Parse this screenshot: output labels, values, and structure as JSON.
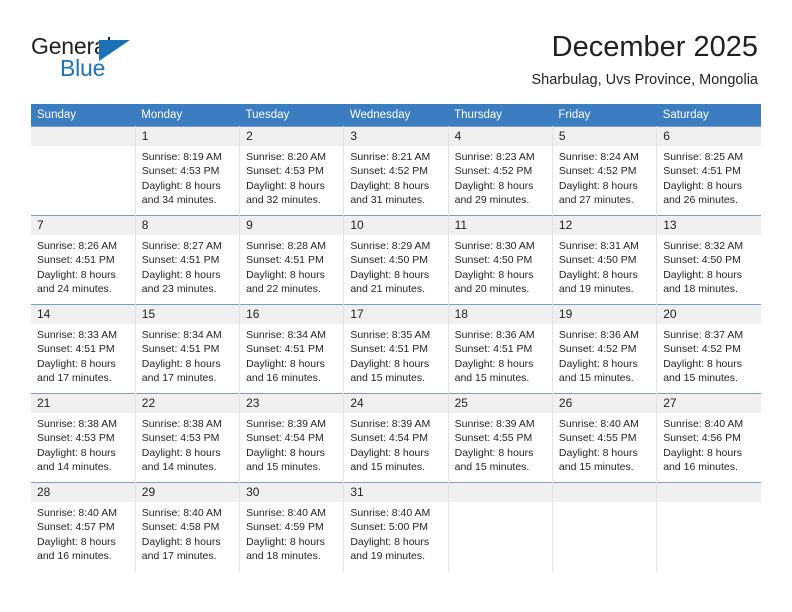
{
  "brand": {
    "name_part1": "General",
    "name_part2": "Blue",
    "triangle_icon": "triangle-logo-icon",
    "accent_color": "#1b72b8"
  },
  "header": {
    "title": "December 2025",
    "subtitle": "Sharbulag, Uvs Province, Mongolia"
  },
  "calendar": {
    "header_bg": "#3b7dc0",
    "daynum_bg": "#f0f0f0",
    "weekdays": [
      "Sunday",
      "Monday",
      "Tuesday",
      "Wednesday",
      "Thursday",
      "Friday",
      "Saturday"
    ],
    "weeks": [
      [
        {
          "day": "",
          "sunrise": "",
          "sunset": "",
          "daylight1": "",
          "daylight2": ""
        },
        {
          "day": "1",
          "sunrise": "Sunrise: 8:19 AM",
          "sunset": "Sunset: 4:53 PM",
          "daylight1": "Daylight: 8 hours",
          "daylight2": "and 34 minutes."
        },
        {
          "day": "2",
          "sunrise": "Sunrise: 8:20 AM",
          "sunset": "Sunset: 4:53 PM",
          "daylight1": "Daylight: 8 hours",
          "daylight2": "and 32 minutes."
        },
        {
          "day": "3",
          "sunrise": "Sunrise: 8:21 AM",
          "sunset": "Sunset: 4:52 PM",
          "daylight1": "Daylight: 8 hours",
          "daylight2": "and 31 minutes."
        },
        {
          "day": "4",
          "sunrise": "Sunrise: 8:23 AM",
          "sunset": "Sunset: 4:52 PM",
          "daylight1": "Daylight: 8 hours",
          "daylight2": "and 29 minutes."
        },
        {
          "day": "5",
          "sunrise": "Sunrise: 8:24 AM",
          "sunset": "Sunset: 4:52 PM",
          "daylight1": "Daylight: 8 hours",
          "daylight2": "and 27 minutes."
        },
        {
          "day": "6",
          "sunrise": "Sunrise: 8:25 AM",
          "sunset": "Sunset: 4:51 PM",
          "daylight1": "Daylight: 8 hours",
          "daylight2": "and 26 minutes."
        }
      ],
      [
        {
          "day": "7",
          "sunrise": "Sunrise: 8:26 AM",
          "sunset": "Sunset: 4:51 PM",
          "daylight1": "Daylight: 8 hours",
          "daylight2": "and 24 minutes."
        },
        {
          "day": "8",
          "sunrise": "Sunrise: 8:27 AM",
          "sunset": "Sunset: 4:51 PM",
          "daylight1": "Daylight: 8 hours",
          "daylight2": "and 23 minutes."
        },
        {
          "day": "9",
          "sunrise": "Sunrise: 8:28 AM",
          "sunset": "Sunset: 4:51 PM",
          "daylight1": "Daylight: 8 hours",
          "daylight2": "and 22 minutes."
        },
        {
          "day": "10",
          "sunrise": "Sunrise: 8:29 AM",
          "sunset": "Sunset: 4:50 PM",
          "daylight1": "Daylight: 8 hours",
          "daylight2": "and 21 minutes."
        },
        {
          "day": "11",
          "sunrise": "Sunrise: 8:30 AM",
          "sunset": "Sunset: 4:50 PM",
          "daylight1": "Daylight: 8 hours",
          "daylight2": "and 20 minutes."
        },
        {
          "day": "12",
          "sunrise": "Sunrise: 8:31 AM",
          "sunset": "Sunset: 4:50 PM",
          "daylight1": "Daylight: 8 hours",
          "daylight2": "and 19 minutes."
        },
        {
          "day": "13",
          "sunrise": "Sunrise: 8:32 AM",
          "sunset": "Sunset: 4:50 PM",
          "daylight1": "Daylight: 8 hours",
          "daylight2": "and 18 minutes."
        }
      ],
      [
        {
          "day": "14",
          "sunrise": "Sunrise: 8:33 AM",
          "sunset": "Sunset: 4:51 PM",
          "daylight1": "Daylight: 8 hours",
          "daylight2": "and 17 minutes."
        },
        {
          "day": "15",
          "sunrise": "Sunrise: 8:34 AM",
          "sunset": "Sunset: 4:51 PM",
          "daylight1": "Daylight: 8 hours",
          "daylight2": "and 17 minutes."
        },
        {
          "day": "16",
          "sunrise": "Sunrise: 8:34 AM",
          "sunset": "Sunset: 4:51 PM",
          "daylight1": "Daylight: 8 hours",
          "daylight2": "and 16 minutes."
        },
        {
          "day": "17",
          "sunrise": "Sunrise: 8:35 AM",
          "sunset": "Sunset: 4:51 PM",
          "daylight1": "Daylight: 8 hours",
          "daylight2": "and 15 minutes."
        },
        {
          "day": "18",
          "sunrise": "Sunrise: 8:36 AM",
          "sunset": "Sunset: 4:51 PM",
          "daylight1": "Daylight: 8 hours",
          "daylight2": "and 15 minutes."
        },
        {
          "day": "19",
          "sunrise": "Sunrise: 8:36 AM",
          "sunset": "Sunset: 4:52 PM",
          "daylight1": "Daylight: 8 hours",
          "daylight2": "and 15 minutes."
        },
        {
          "day": "20",
          "sunrise": "Sunrise: 8:37 AM",
          "sunset": "Sunset: 4:52 PM",
          "daylight1": "Daylight: 8 hours",
          "daylight2": "and 15 minutes."
        }
      ],
      [
        {
          "day": "21",
          "sunrise": "Sunrise: 8:38 AM",
          "sunset": "Sunset: 4:53 PM",
          "daylight1": "Daylight: 8 hours",
          "daylight2": "and 14 minutes."
        },
        {
          "day": "22",
          "sunrise": "Sunrise: 8:38 AM",
          "sunset": "Sunset: 4:53 PM",
          "daylight1": "Daylight: 8 hours",
          "daylight2": "and 14 minutes."
        },
        {
          "day": "23",
          "sunrise": "Sunrise: 8:39 AM",
          "sunset": "Sunset: 4:54 PM",
          "daylight1": "Daylight: 8 hours",
          "daylight2": "and 15 minutes."
        },
        {
          "day": "24",
          "sunrise": "Sunrise: 8:39 AM",
          "sunset": "Sunset: 4:54 PM",
          "daylight1": "Daylight: 8 hours",
          "daylight2": "and 15 minutes."
        },
        {
          "day": "25",
          "sunrise": "Sunrise: 8:39 AM",
          "sunset": "Sunset: 4:55 PM",
          "daylight1": "Daylight: 8 hours",
          "daylight2": "and 15 minutes."
        },
        {
          "day": "26",
          "sunrise": "Sunrise: 8:40 AM",
          "sunset": "Sunset: 4:55 PM",
          "daylight1": "Daylight: 8 hours",
          "daylight2": "and 15 minutes."
        },
        {
          "day": "27",
          "sunrise": "Sunrise: 8:40 AM",
          "sunset": "Sunset: 4:56 PM",
          "daylight1": "Daylight: 8 hours",
          "daylight2": "and 16 minutes."
        }
      ],
      [
        {
          "day": "28",
          "sunrise": "Sunrise: 8:40 AM",
          "sunset": "Sunset: 4:57 PM",
          "daylight1": "Daylight: 8 hours",
          "daylight2": "and 16 minutes."
        },
        {
          "day": "29",
          "sunrise": "Sunrise: 8:40 AM",
          "sunset": "Sunset: 4:58 PM",
          "daylight1": "Daylight: 8 hours",
          "daylight2": "and 17 minutes."
        },
        {
          "day": "30",
          "sunrise": "Sunrise: 8:40 AM",
          "sunset": "Sunset: 4:59 PM",
          "daylight1": "Daylight: 8 hours",
          "daylight2": "and 18 minutes."
        },
        {
          "day": "31",
          "sunrise": "Sunrise: 8:40 AM",
          "sunset": "Sunset: 5:00 PM",
          "daylight1": "Daylight: 8 hours",
          "daylight2": "and 19 minutes."
        },
        {
          "day": "",
          "sunrise": "",
          "sunset": "",
          "daylight1": "",
          "daylight2": ""
        },
        {
          "day": "",
          "sunrise": "",
          "sunset": "",
          "daylight1": "",
          "daylight2": ""
        },
        {
          "day": "",
          "sunrise": "",
          "sunset": "",
          "daylight1": "",
          "daylight2": ""
        }
      ]
    ]
  }
}
